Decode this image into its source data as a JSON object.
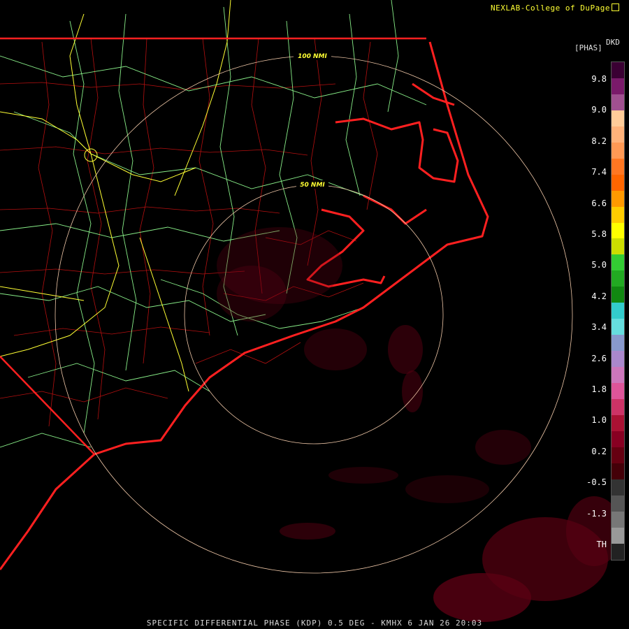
{
  "header": {
    "credit": "NEXLAB-College of DuPage"
  },
  "legend": {
    "unit_main": "[PHAS]",
    "unit_sub": "DKD",
    "ticks": [
      "9.8",
      "9.0",
      "8.2",
      "7.4",
      "6.6",
      "5.8",
      "5.0",
      "4.2",
      "3.4",
      "2.6",
      "1.8",
      "1.0",
      "0.2",
      "-0.5",
      "-1.3",
      "TH"
    ],
    "colors": [
      "#3a0033",
      "#7a1a6a",
      "#a05090",
      "#ffcc99",
      "#ffb27a",
      "#ff9955",
      "#ff7722",
      "#ff6600",
      "#ff9900",
      "#ffcc00",
      "#ffff00",
      "#ccdd00",
      "#33cc33",
      "#22aa22",
      "#118811",
      "#33cccc",
      "#66dddd",
      "#8899cc",
      "#aa88cc",
      "#cc77bb",
      "#dd5599",
      "#cc3366",
      "#aa1133",
      "#880022",
      "#660011",
      "#440008",
      "#333333",
      "#555555",
      "#777777",
      "#999999",
      "#222222"
    ]
  },
  "map": {
    "range_rings": [
      {
        "label": "50 NMI"
      },
      {
        "label": "100 NMI"
      }
    ],
    "colors": {
      "state_border": "#ff2020",
      "county": "#cc1111",
      "highway": "#99ff99",
      "interstate": "#ffff33",
      "ring": "#f0c8a8",
      "echo": "#7a0018"
    }
  },
  "footer": {
    "caption": "SPECIFIC DIFFERENTIAL PHASE (KDP) 0.5 DEG - KMHX 6 JAN 26 20:03"
  }
}
